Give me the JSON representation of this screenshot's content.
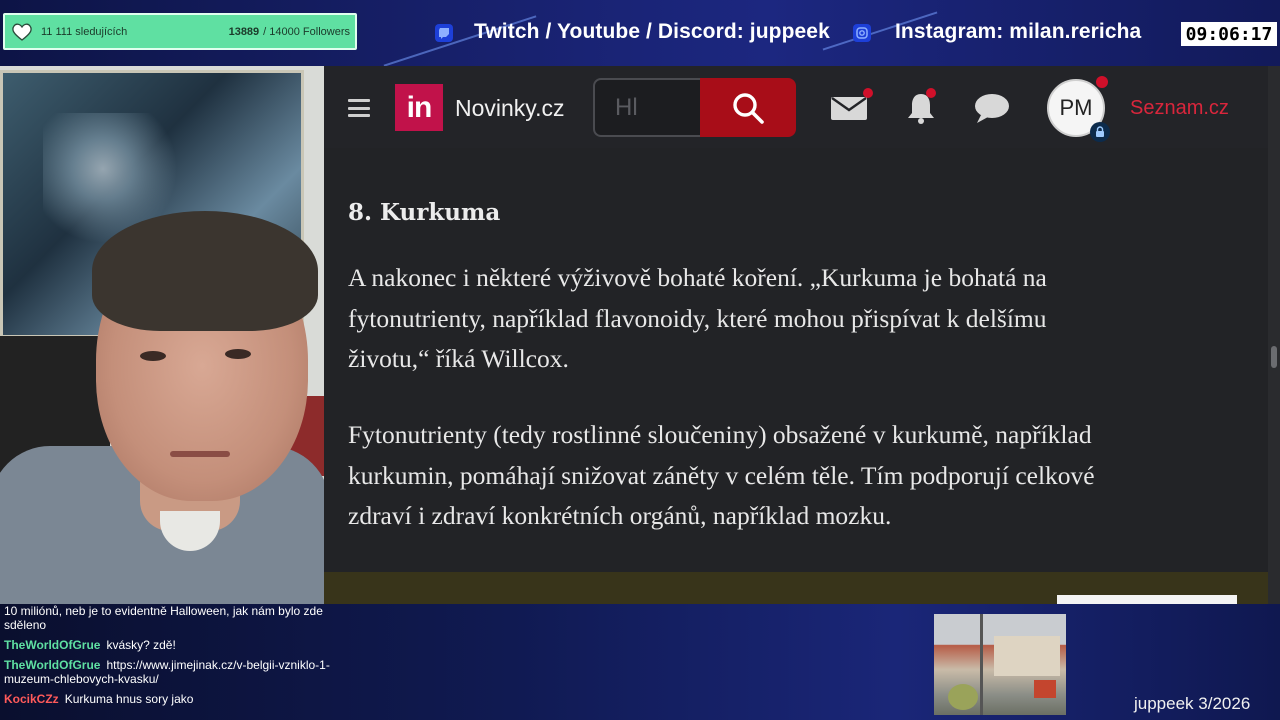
{
  "overlay_top": {
    "follower_label": "11 111 sledujících",
    "follower_count": "13889",
    "follower_goal": "/ 14000 Followers",
    "social_primary": "Twitch / Youtube / Discord: juppeek",
    "social_secondary": "Instagram: milan.rericha",
    "clock": "09:06:17"
  },
  "browser": {
    "site_name": "Novinky.cz",
    "logo_text": "in",
    "search_placeholder": "Hl",
    "avatar_initials": "PM",
    "seznam_link": "Seznam.cz"
  },
  "article": {
    "heading": "8. Kurkuma",
    "paragraphs": [
      [
        "A nakonec i některé výživově bohaté koření. „Kurkuma je bohatá na",
        "fytonutrienty, například flavonoidy, které mohou přispívat k delšímu",
        "životu,“ říká Willcox."
      ],
      [
        "Fytonutrienty (tedy rostlinné sloučeniny) obsažené v kurkumě, například",
        "kurkumin, pomáhají snižovat záněty v celém těle. Tím podporují celkové",
        "zdraví i zdraví konkrétních orgánů, například mozku."
      ]
    ]
  },
  "chat": {
    "messages": [
      {
        "user": "",
        "user_color": "#ffffff",
        "text": "10 miliónů, neb je to evidentně Halloween, jak nám bylo zde sděleno"
      },
      {
        "user": "TheWorldOfGrue",
        "user_color": "#5fe0a2",
        "text": "kvásky? zdě!"
      },
      {
        "user": "TheWorldOfGrue",
        "user_color": "#5fe0a2",
        "text": "https://www.jimejinak.cz/v-belgii-vzniklo-1-muzeum-chlebovych-kvasku/"
      },
      {
        "user": "KocikCZz",
        "user_color": "#ff5a5a",
        "text": "Kurkuma hnus sory jako"
      }
    ]
  },
  "overlay_bottom": {
    "watermark": "juppeek 3/2026"
  },
  "colors": {
    "follower_box": "#5fe0a2",
    "novinky_brand": "#c1124a",
    "search_button": "#a80d18",
    "seznam_red": "#d9263c",
    "notification_dot": "#d0102a"
  },
  "icons": {
    "follower": "heart-hands-icon",
    "twitch": "twitch-icon",
    "instagram": "instagram-icon",
    "menu": "hamburger-icon",
    "search": "search-icon",
    "mail": "mail-icon",
    "bell": "bell-icon",
    "chat": "chat-bubble-icon",
    "lock": "lock-icon"
  }
}
